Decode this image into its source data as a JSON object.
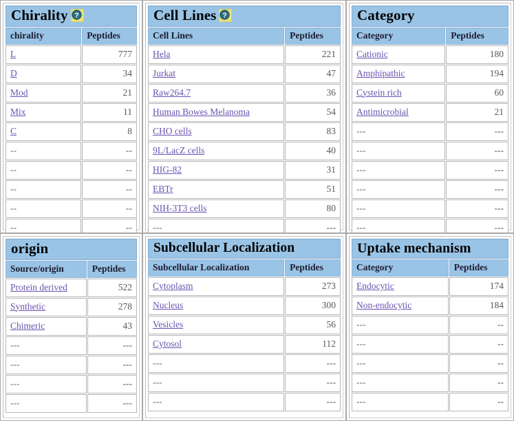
{
  "help_icon_name": "question-mark-help-icon",
  "colors": {
    "header_blue": "#9ac4e6",
    "link_purple": "#6a53b0",
    "value_gray": "#5a5a5a",
    "help_icon_yellow": "#e8e27a",
    "help_icon_circle": "#2a6f87",
    "panel_border": "#a8a8a8"
  },
  "panels": [
    {
      "id": "chirality",
      "title": "Chirality",
      "has_help_icon": true,
      "columns": [
        "chirality",
        "Peptides"
      ],
      "rows": [
        {
          "label": "L",
          "link": true,
          "value": "777"
        },
        {
          "label": "D",
          "link": true,
          "value": "34"
        },
        {
          "label": "Mod",
          "link": true,
          "value": "21"
        },
        {
          "label": "Mix",
          "link": true,
          "value": "11"
        },
        {
          "label": "C",
          "link": true,
          "value": "8"
        },
        {
          "label": "--",
          "link": false,
          "value": "--"
        },
        {
          "label": "--",
          "link": false,
          "value": "--"
        },
        {
          "label": "--",
          "link": false,
          "value": "--"
        },
        {
          "label": "--",
          "link": false,
          "value": "--"
        },
        {
          "label": "--",
          "link": false,
          "value": "--"
        }
      ]
    },
    {
      "id": "cell-lines",
      "title": "Cell Lines",
      "has_help_icon": true,
      "columns": [
        "Cell Lines",
        "Peptides"
      ],
      "rows": [
        {
          "label": "Hela",
          "link": true,
          "value": "221"
        },
        {
          "label": "Jurkat",
          "link": true,
          "value": "47"
        },
        {
          "label": "Raw264.7",
          "link": true,
          "value": "36"
        },
        {
          "label": "Human Bowes Melanoma",
          "link": true,
          "value": "54"
        },
        {
          "label": "CHO cells",
          "link": true,
          "value": "83"
        },
        {
          "label": "9L/LacZ cells",
          "link": true,
          "value": "40"
        },
        {
          "label": "HIG-82",
          "link": true,
          "value": "31"
        },
        {
          "label": "EBTr",
          "link": true,
          "value": "51"
        },
        {
          "label": "NIH-3T3 cells",
          "link": true,
          "value": "80"
        },
        {
          "label": "---",
          "link": false,
          "value": "---"
        }
      ]
    },
    {
      "id": "category",
      "title": "Category",
      "has_help_icon": false,
      "columns": [
        "Category",
        "Peptides"
      ],
      "rows": [
        {
          "label": "Cationic",
          "link": true,
          "value": "180"
        },
        {
          "label": "Amphipathic",
          "link": true,
          "value": "194"
        },
        {
          "label": "Cystein rich",
          "link": true,
          "value": "60"
        },
        {
          "label": "Antimicrobial",
          "link": true,
          "value": "21"
        },
        {
          "label": "---",
          "link": false,
          "value": "---"
        },
        {
          "label": "---",
          "link": false,
          "value": "---"
        },
        {
          "label": "---",
          "link": false,
          "value": "---"
        },
        {
          "label": "---",
          "link": false,
          "value": "---"
        },
        {
          "label": "---",
          "link": false,
          "value": "---"
        },
        {
          "label": "---",
          "link": false,
          "value": "---"
        }
      ]
    },
    {
      "id": "origin",
      "title": "origin",
      "has_help_icon": false,
      "columns": [
        "Source/origin",
        "Peptides"
      ],
      "rows": [
        {
          "label": "Protein derived",
          "link": true,
          "value": "522"
        },
        {
          "label": "Synthetic",
          "link": true,
          "value": "278"
        },
        {
          "label": "Chimeric",
          "link": true,
          "value": "43"
        },
        {
          "label": "---",
          "link": false,
          "value": "---"
        },
        {
          "label": "---",
          "link": false,
          "value": "---"
        },
        {
          "label": "---",
          "link": false,
          "value": "---"
        },
        {
          "label": "---",
          "link": false,
          "value": "---"
        }
      ]
    },
    {
      "id": "subcellular-localization",
      "title": "Subcellular Localization",
      "has_help_icon": false,
      "columns": [
        "Subcellular Localization",
        "Peptides"
      ],
      "rows": [
        {
          "label": "Cytoplasm",
          "link": true,
          "value": "273"
        },
        {
          "label": "Nucleus",
          "link": true,
          "value": "300"
        },
        {
          "label": "Vesicles",
          "link": true,
          "value": "56"
        },
        {
          "label": "Cytosol",
          "link": true,
          "value": "112"
        },
        {
          "label": "---",
          "link": false,
          "value": "---"
        },
        {
          "label": "---",
          "link": false,
          "value": "---"
        },
        {
          "label": "---",
          "link": false,
          "value": "---"
        }
      ]
    },
    {
      "id": "uptake-mechanism",
      "title": "Uptake mechanism",
      "has_help_icon": false,
      "columns": [
        "Category",
        "Peptides"
      ],
      "rows": [
        {
          "label": "Endocytic",
          "link": true,
          "value": "174"
        },
        {
          "label": "Non-endocytic",
          "link": true,
          "value": "184"
        },
        {
          "label": "---",
          "link": false,
          "value": "--"
        },
        {
          "label": "---",
          "link": false,
          "value": "--"
        },
        {
          "label": "---",
          "link": false,
          "value": "--"
        },
        {
          "label": "---",
          "link": false,
          "value": "--"
        },
        {
          "label": "---",
          "link": false,
          "value": "--"
        }
      ]
    }
  ]
}
